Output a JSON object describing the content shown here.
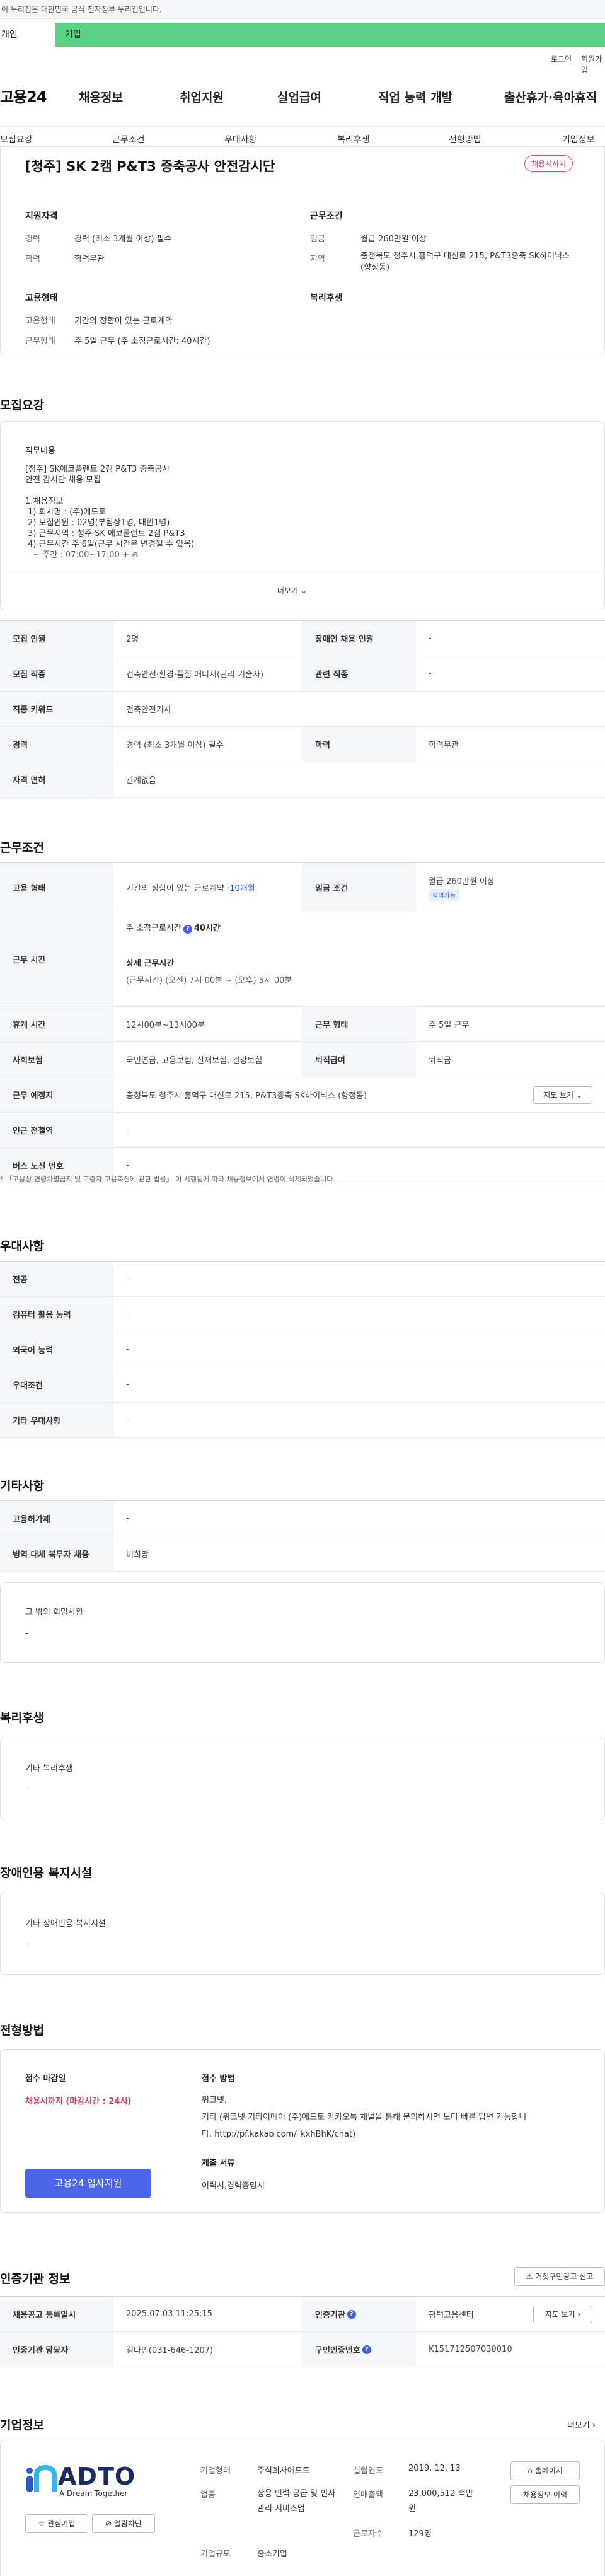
{
  "banner": {
    "text": "이 누리집은 대한민국 공식 전자정부 누리집입니다."
  },
  "user_tabs": {
    "individual": "개인",
    "business": "기업"
  },
  "util": {
    "login": "로그인",
    "signup": "회원가입"
  },
  "gnb": {
    "logo": "고용24",
    "menu": [
      "채용정보",
      "취업지원",
      "실업급여",
      "직업 능력 개발",
      "출산휴가·육아휴직"
    ]
  },
  "subnav": [
    "모집요강",
    "근무조건",
    "우대사항",
    "복리후생",
    "전형방법",
    "기업정보"
  ],
  "summary": {
    "title": "[청주] SK 2캠 P&T3 증축공사 안전감시단",
    "deadline_badge": "채용시까지",
    "qual_heading": "지원자격",
    "cond_heading": "근무조건",
    "career_label": "경력",
    "career_value": "경력 (최소 3개월 이상) 필수",
    "edu_label": "학력",
    "edu_value": "학력무관",
    "wage_label": "임금",
    "wage_value": "월급 260만원 이상",
    "region_label": "지역",
    "region_value": "충청북도 청주시 흥덕구 대신로 215, P&T3증축 SK하이닉스 (향정동)",
    "emp_heading": "고용형태",
    "welfare_heading": "복리후생",
    "emptype_label": "고용형태",
    "emptype_value": "기간의 정함이 있는 근로계약",
    "worktype_label": "근무형태",
    "worktype_value": "주 5일 근무 (주 소정근로시간: 40시간)"
  },
  "recruit": {
    "section_title": "모집요강",
    "job_desc_heading": "직무내용",
    "job_desc_lines": [
      "[청주] SK에코플랜트 2캠 P&T3 증축공사",
      "안전 감시단 채용 모집",
      "",
      "1.채용정보",
      " 1) 회사명 : (주)에드토",
      " 2) 모집인원 : 02명(부팀장1명, 대원1명)",
      " 3) 근무지역 : 청주 SK 에코플랜트 2캠 P&T3",
      " 4) 근무시간 주 6일(근무 시간은 변경될 수 있음)",
      "   ~ 주간 : 07:00~17:00 + ⊕"
    ],
    "more": "더보기",
    "rows": [
      {
        "l1": "모집 인원",
        "v1": "2명",
        "l2": "장애인 채용 인원",
        "v2": "-"
      },
      {
        "l1": "모집 직종",
        "v1": "건축안전·환경·품질 매니저(관리 기술자)",
        "l2": "관련 직종",
        "v2": "-"
      },
      {
        "l1": "직종 키워드",
        "v1": "건축안전기사"
      },
      {
        "l1": "경력",
        "v1": "경력 (최소 3개월 이상) 필수",
        "l2": "학력",
        "v2": "학력무관"
      },
      {
        "l1": "자격 면허",
        "v1": "관계없음"
      }
    ]
  },
  "work": {
    "section_title": "근무조건",
    "emp_label": "고용 형태",
    "emp_value": "기간의 정함이 있는 근로계약 · ",
    "emp_months": "10개월",
    "wage_label": "임금 조건",
    "wage_value": "월급 260만원 이상",
    "wage_tag": "협의가능",
    "hours_label": "근무 시간",
    "hours_weekly": "주 소정근로시간",
    "hours_weekly_value": "40시간",
    "hours_detail_heading": "상세 근무시간",
    "hours_detail": "(근무시간) (오전) 7시 00분 ~ (오후) 5시 00분",
    "rest_label": "휴게 시간",
    "rest_value": "12시00분~13시00분",
    "worktype_label": "근무 형태",
    "worktype_value": "주 5일 근무",
    "insurance_label": "사회보험",
    "insurance_value": "국민연금, 고용보험, 산재보험, 건강보험",
    "retire_label": "퇴직급여",
    "retire_value": "퇴직금",
    "place_label": "근무 예정지",
    "place_value": "충청북도 청주시 흥덕구 대신로 215, P&T3증축 SK하이닉스 (향정동)",
    "map_btn": "지도 보기",
    "station_label": "인근 전철역",
    "station_value": "-",
    "bus_label": "버스 노선 번호",
    "bus_value": "-",
    "note": "「고용상 연령차별금지 및 고령자 고용촉진에 관한 법률」 이 시행됨에 따라 채용정보에서 연령이 삭제되었습니다."
  },
  "pref": {
    "section_title": "우대사항",
    "rows": [
      {
        "l": "전공",
        "v": "-"
      },
      {
        "l": "컴퓨터 활용 능력",
        "v": "-"
      },
      {
        "l": "외국어 능력",
        "v": "-"
      },
      {
        "l": "우대조건",
        "v": "-"
      },
      {
        "l": "기타 우대사항",
        "v": "-"
      }
    ]
  },
  "etc": {
    "section_title": "기타사항",
    "rows": [
      {
        "l": "고용허가제",
        "v": "-"
      },
      {
        "l": "병역 대체 복무자 채용",
        "v": "비희망"
      }
    ],
    "other_heading": "그 밖의 희망사항",
    "other_value": "-"
  },
  "welfare": {
    "section_title": "복리후생",
    "heading": "기타 복리후생",
    "value": "-"
  },
  "disability": {
    "section_title": "장애인용 복지시설",
    "heading": "기타 장애인용 복지시설",
    "value": "-"
  },
  "process": {
    "section_title": "전형방법",
    "deadline_heading": "접수 마감일",
    "deadline_value": "채용시까지 (마감시간 : 24시)",
    "method_heading": "접수 방법",
    "method_lines": [
      "워크넷,",
      "기타 (워크넷 기타이메이 (주)에드토 카카오톡 채널을 통해 문의하시면 보다 빠른 답변 가능합니",
      "다. http://pf.kakao.com/_kxhBhK/chat)"
    ],
    "docs_heading": "제출 서류",
    "docs_value": "이력서,경력증명서",
    "apply_btn": "고용24 입사지원"
  },
  "cert": {
    "section_title": "인증기관 정보",
    "report_btn": "거짓구인광고 신고",
    "rows": [
      {
        "l1": "채용공고 등록일시",
        "v1": "2025.07.03 11:25:15",
        "l2": "인증기관",
        "v2": "평택고용센터",
        "btn": "지도 보기"
      },
      {
        "l1": "인증기관 담당자",
        "v1": "김다인(031-646-1207)",
        "l2": "구인인증번호",
        "v2": "K151712507030010"
      }
    ]
  },
  "company": {
    "section_title": "기업정보",
    "more": "더보기",
    "logo_text": "ADTO",
    "logo_slogan": "A Dream Together",
    "fav_btn": "관심기업",
    "block_btn": "열람차단",
    "type_label": "기업형태",
    "type_value": "주식회사에드토",
    "industry_label": "업종",
    "industry_value": "상용 인력 공급 및 인사관리 서비스업",
    "size_label": "기업규모",
    "size_value": "중소기업",
    "founded_label": "설립연도",
    "founded_value": "2019. 12. 13",
    "sales_label": "연매출액",
    "sales_value": "23,000,512 백만원",
    "emp_label": "근로자수",
    "emp_value": "129명",
    "home_btn": "홈페이지",
    "jobs_btn": "채용정보 이력"
  },
  "colors": {
    "green": "#5bd186",
    "blue": "#4a66e8",
    "red": "#e0395f"
  }
}
